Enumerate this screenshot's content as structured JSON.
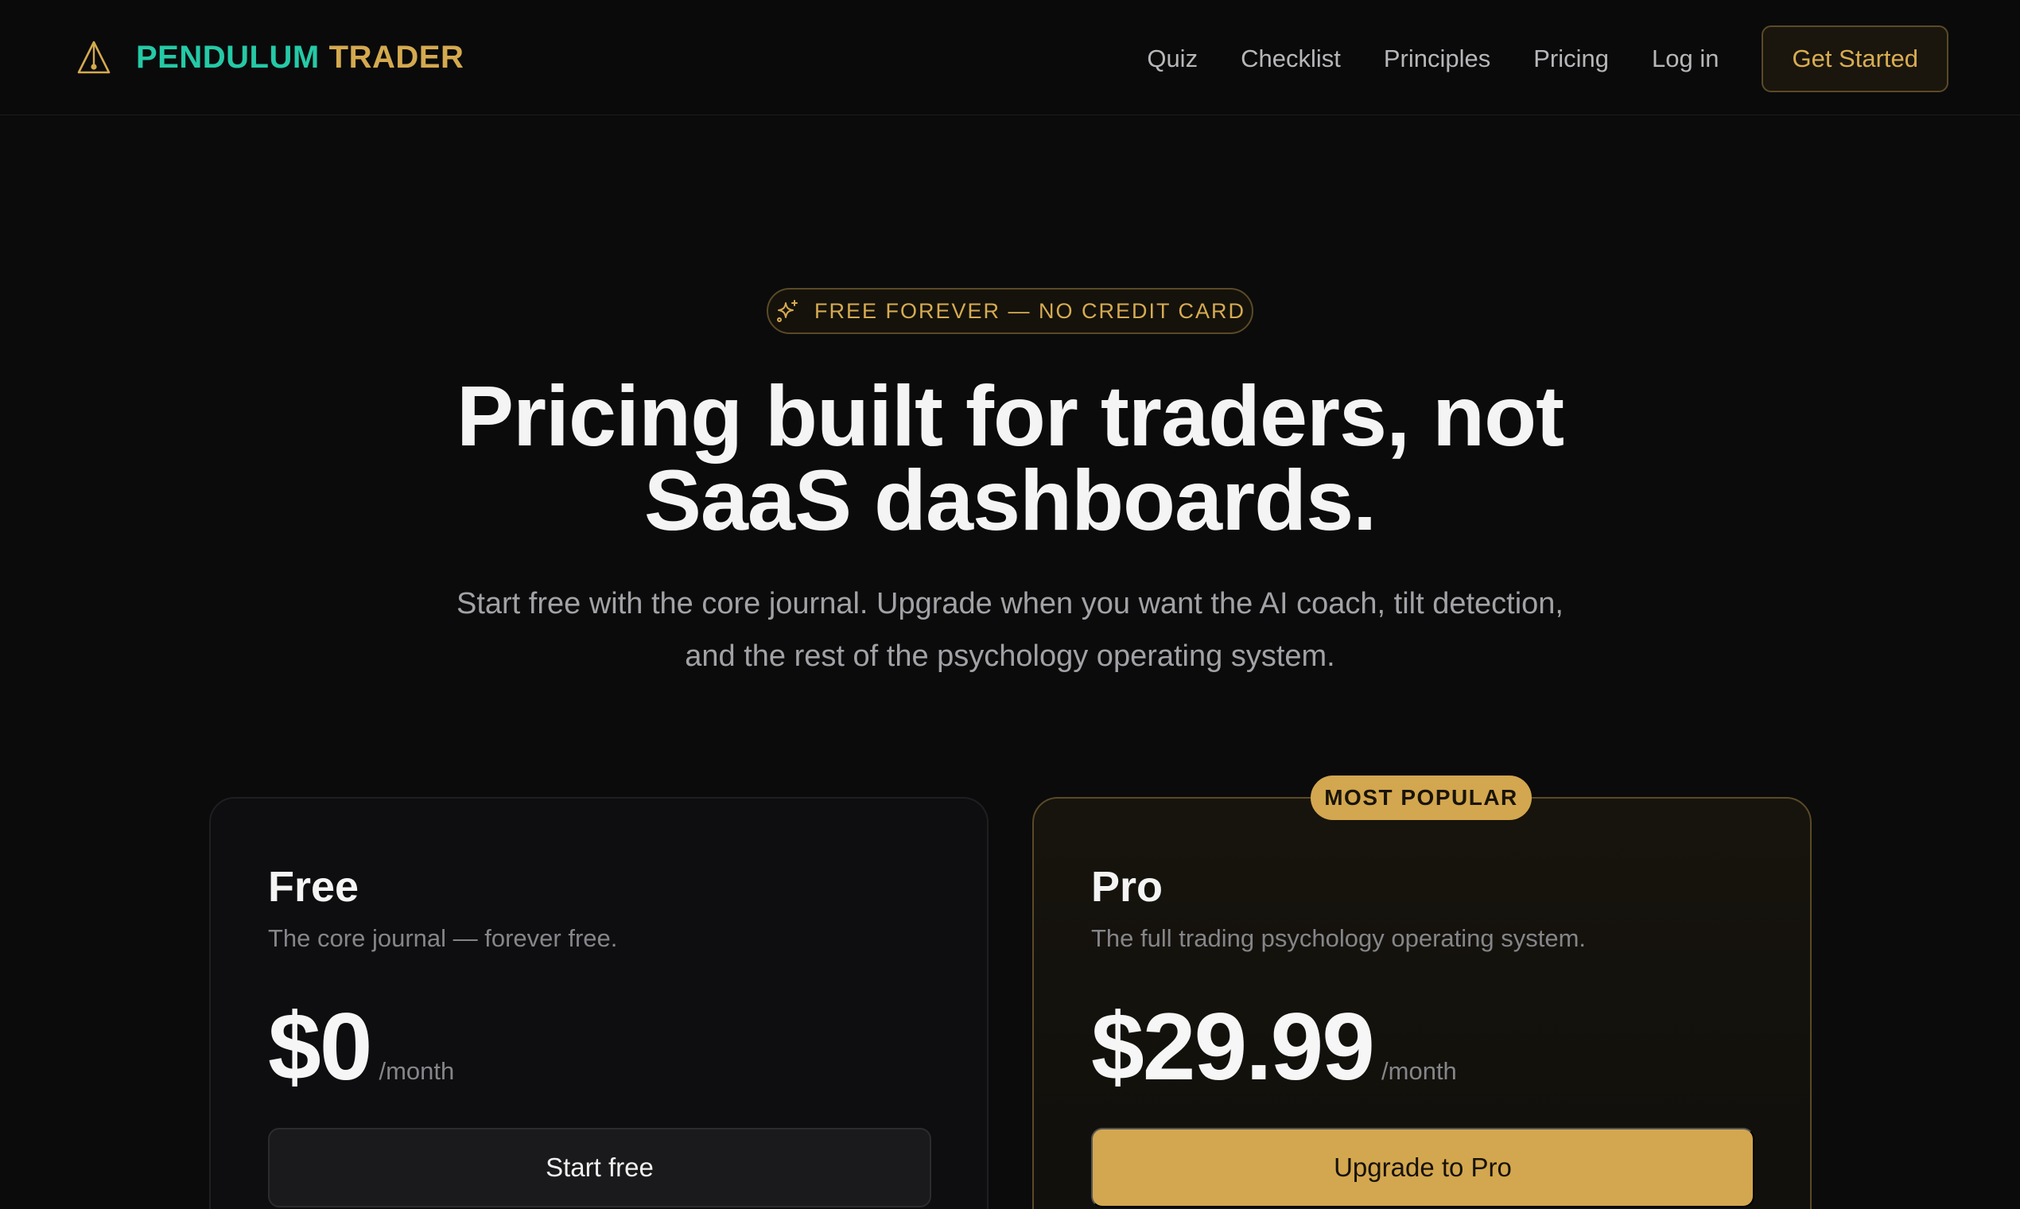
{
  "brand": {
    "name_part1": "PENDULUM",
    "name_part2": "TRADER",
    "icon": "pendulum-triangle-icon"
  },
  "nav": {
    "links": [
      "Quiz",
      "Checklist",
      "Principles",
      "Pricing",
      "Log in"
    ],
    "cta": "Get Started"
  },
  "hero": {
    "badge": "FREE FOREVER — NO CREDIT CARD",
    "badge_icon": "sparkles-icon",
    "title_line1": "Pricing built for traders, not",
    "title_line2": "SaaS dashboards.",
    "subtitle_line1": "Start free with the core journal. Upgrade when you want the AI coach, tilt detection,",
    "subtitle_line2": "and the rest of the psychology operating system."
  },
  "plans": [
    {
      "name": "Free",
      "description": "The core journal — forever free.",
      "price": "$0",
      "period": "/month",
      "button": "Start free"
    },
    {
      "name": "Pro",
      "badge": "MOST POPULAR",
      "description": "The full trading psychology operating system.",
      "price": "$29.99",
      "period": "/month",
      "button": "Upgrade to Pro"
    }
  ],
  "colors": {
    "background": "#0b0b0c",
    "accent_gold": "#d3a74f",
    "accent_teal": "#25c9a6"
  }
}
